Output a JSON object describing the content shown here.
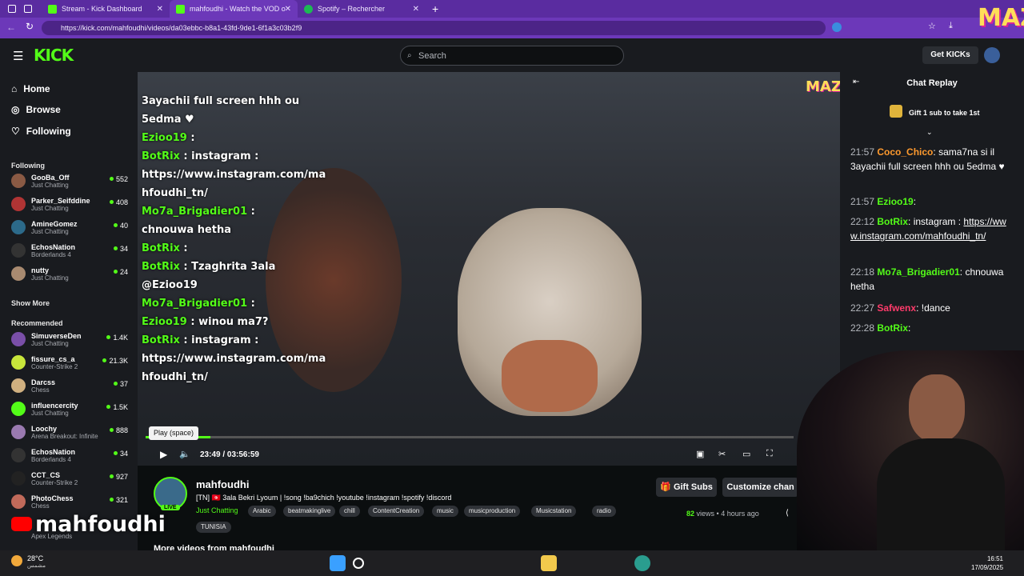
{
  "browser": {
    "tabs": [
      {
        "title": "Stream - Kick Dashboard",
        "color": "#53fc18"
      },
      {
        "title": "mahfoudhi - Watch the VOD on Kick",
        "color": "#53fc18"
      },
      {
        "title": "Spotify – Rechercher",
        "color": "#1db954"
      }
    ],
    "url": "https://kick.com/mahfoudhi/videos/da03ebbc-b8a1-43fd-9de1-6f1a3c03b2f9"
  },
  "header": {
    "logo": "KICK",
    "search_placeholder": "Search",
    "get_kicks": "Get KICKs"
  },
  "sidebar": {
    "nav": [
      {
        "label": "Home",
        "icon": "home-icon"
      },
      {
        "label": "Browse",
        "icon": "compass-icon"
      },
      {
        "label": "Following",
        "icon": "heart-icon"
      }
    ],
    "following_title": "Following",
    "following": [
      {
        "name": "GooBa_Off",
        "game": "Just Chatting",
        "viewers": "552",
        "color": "#8a5a44"
      },
      {
        "name": "Parker_Seifddine",
        "game": "Just Chatting",
        "viewers": "408",
        "color": "#b03434"
      },
      {
        "name": "AmineGomez",
        "game": "Just Chatting",
        "viewers": "40",
        "color": "#2c6a8a"
      },
      {
        "name": "EchosNation",
        "game": "Borderlands 4",
        "viewers": "34",
        "color": "#333"
      },
      {
        "name": "nutty",
        "game": "Just Chatting",
        "viewers": "24",
        "color": "#a88a70"
      }
    ],
    "show_more": "Show More",
    "recommended_title": "Recommended",
    "recommended": [
      {
        "name": "SimuverseDen",
        "game": "Just Chatting",
        "viewers": "1.4K",
        "color": "#7a4fa8"
      },
      {
        "name": "fissure_cs_a",
        "game": "Counter-Strike 2",
        "viewers": "21.3K",
        "color": "#c8e63b"
      },
      {
        "name": "Darcss",
        "game": "Chess",
        "viewers": "37",
        "color": "#d0b080"
      },
      {
        "name": "influencercity",
        "game": "Just Chatting",
        "viewers": "1.5K",
        "color": "#53fc18"
      },
      {
        "name": "Loochy",
        "game": "Arena Breakout: Infinite",
        "viewers": "888",
        "color": "#9a7ab0"
      },
      {
        "name": "EchosNation",
        "game": "Borderlands 4",
        "viewers": "34",
        "color": "#333"
      },
      {
        "name": "CCT_CS",
        "game": "Counter-Strike 2",
        "viewers": "927",
        "color": "#222"
      },
      {
        "name": "PhotoChess",
        "game": "Chess",
        "viewers": "321",
        "color": "#c06a5a"
      }
    ],
    "partial_game": "Apex Legends"
  },
  "video_chat_overlay": [
    {
      "text": "3ayachii full screen hhh ou"
    },
    {
      "text": "5edma ♥"
    },
    {
      "user": "Ezioo19",
      "text": " : "
    },
    {
      "user": "BotRix",
      "text": " : instagram :"
    },
    {
      "text": "https://www.instagram.com/ma"
    },
    {
      "text": "hfoudhi_tn/"
    },
    {
      "user": "Mo7a_Brigadier01",
      "text": " :"
    },
    {
      "text": "chnouwa hetha"
    },
    {
      "user": "BotRix",
      "text": " : "
    },
    {
      "user": "BotRix",
      "text": " : Tzaghrita 3ala"
    },
    {
      "text": "@Ezioo19"
    },
    {
      "user": "Mo7a_Brigadier01",
      "text": " : "
    },
    {
      "user": "Ezioo19",
      "text": " : winou ma7?"
    },
    {
      "user": "BotRix",
      "text": " : instagram :"
    },
    {
      "text": "https://www.instagram.com/ma"
    },
    {
      "text": "hfoudhi_tn/"
    }
  ],
  "player": {
    "tooltip": "Play (space)",
    "time": "23:49 / 03:56:59",
    "progress": 0.1
  },
  "stream": {
    "name": "mahfoudhi",
    "title": "[TN] 🇹🇳 3ala Bekri Lyoum | !song !ba9chich !youtube !instagram !spotify !discord",
    "category": "Just Chatting",
    "tags": [
      "Arabic",
      "beatmakinglive",
      "chill",
      "ContentCreation",
      "music",
      "musicproduction",
      "Musicstation",
      "radio",
      "TUNISIA"
    ],
    "live": "LIVE",
    "gift_subs": "Gift Subs",
    "customize": "Customize chan",
    "views": "82",
    "views_label": "views",
    "ago": "4 hours ago",
    "more_videos": "More videos from mahfoudhi"
  },
  "chat": {
    "title": "Chat Replay",
    "gift_banner": "Gift 1 sub to take 1st",
    "messages": [
      {
        "time": "21:57",
        "user": "Coco_Chico",
        "color": "#ff9a2e",
        "text": "sama7na si il 3ayachii full screen hhh ou 5edma ♥"
      },
      {
        "time": "21:57",
        "user": "Ezioo19",
        "color": "#53fc18",
        "text": ""
      },
      {
        "time": "22:12",
        "user": "BotRix",
        "color": "#53fc18",
        "text": "instagram :",
        "link": "https://www.instagram.com/mahfoudhi_tn/"
      },
      {
        "time": "22:18",
        "user": "Mo7a_Brigadier01",
        "color": "#53fc18",
        "text": "chnouwa hetha"
      },
      {
        "time": "22:27",
        "user": "Safwenx",
        "color": "#ff3b6b",
        "text": "!dance"
      },
      {
        "time": "22:28",
        "user": "BotRix",
        "color": "#53fc18",
        "text": ""
      }
    ]
  },
  "overlay_text": "mahfoudhi",
  "overlay_logo": "MAZ",
  "taskbar": {
    "temp": "28°C",
    "weather_sub": "مشمس",
    "time": "16:51",
    "date": "17/09/2025"
  }
}
